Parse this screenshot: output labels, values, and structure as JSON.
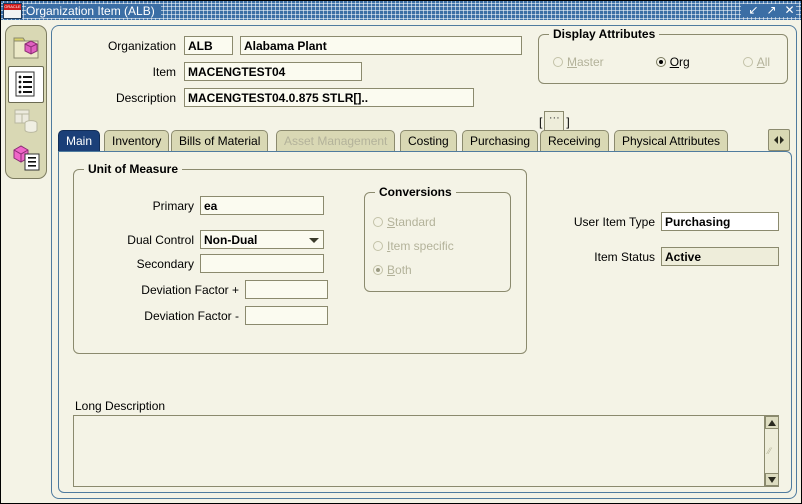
{
  "window": {
    "title": "Organization Item (ALB)",
    "logo_text": "ORACLE",
    "buttons": [
      {
        "name": "minimize",
        "glyph": "↙"
      },
      {
        "name": "maximize",
        "glyph": "↗"
      },
      {
        "name": "close",
        "glyph": "✕"
      }
    ]
  },
  "sidebar": {
    "items": [
      {
        "name": "folder-cube-icon",
        "label": "Navigator Folder",
        "state": "enabled"
      },
      {
        "name": "list-document-icon",
        "label": "Item List",
        "state": "selected"
      },
      {
        "name": "window-database-icon",
        "label": "Data Window",
        "state": "disabled"
      },
      {
        "name": "cube-list-icon",
        "label": "Item Attributes",
        "state": "enabled"
      }
    ]
  },
  "header": {
    "organization": {
      "label": "Organization",
      "code_value": "ALB",
      "name_value": "Alabama Plant"
    },
    "item": {
      "label": "Item",
      "value": "MACENGTEST04"
    },
    "description": {
      "label": "Description",
      "value": "MACENGTEST04.0.875 STLR[]..",
      "lov_open": "[",
      "lov_glyph": "···",
      "lov_close": "]"
    }
  },
  "display_attributes": {
    "title": "Display Attributes",
    "options": [
      {
        "label_pre": "",
        "label_accel": "M",
        "label_post": "aster",
        "selected": false,
        "disabled": true
      },
      {
        "label_pre": "",
        "label_accel": "O",
        "label_post": "rg",
        "selected": true,
        "disabled": false
      },
      {
        "label_pre": "",
        "label_accel": "A",
        "label_post": "ll",
        "selected": false,
        "disabled": true
      }
    ]
  },
  "tabs": {
    "items": [
      {
        "label": "Main",
        "selected": true,
        "disabled": false
      },
      {
        "label": "Inventory",
        "selected": false,
        "disabled": false
      },
      {
        "label": "Bills of Material",
        "selected": false,
        "disabled": false
      },
      {
        "label": "Asset Management",
        "selected": false,
        "disabled": true
      },
      {
        "label": "Costing",
        "selected": false,
        "disabled": false
      },
      {
        "label": "Purchasing",
        "selected": false,
        "disabled": false
      },
      {
        "label": "Receiving",
        "selected": false,
        "disabled": false
      },
      {
        "label": "Physical Attributes",
        "selected": false,
        "disabled": false
      }
    ],
    "nav_button_name": "tab-scroll-button"
  },
  "main_tab": {
    "uom": {
      "title": "Unit of Measure",
      "primary": {
        "label": "Primary",
        "value": "ea"
      },
      "dual_control": {
        "label": "Dual Control",
        "value": "Non-Dual"
      },
      "secondary": {
        "label": "Secondary",
        "value": ""
      },
      "deviation_plus": {
        "label": "Deviation Factor +",
        "value": ""
      },
      "deviation_minus": {
        "label": "Deviation Factor -",
        "value": ""
      },
      "conversions": {
        "title": "Conversions",
        "options": [
          {
            "label_accel": "S",
            "label_post": "tandard",
            "selected": false,
            "disabled": true
          },
          {
            "label_accel": "I",
            "label_post": "tem specific",
            "selected": false,
            "disabled": true
          },
          {
            "label_accel": "B",
            "label_post": "oth",
            "selected": true,
            "disabled": true
          }
        ]
      }
    },
    "user_item_type": {
      "label": "User Item Type",
      "value": "Purchasing"
    },
    "item_status": {
      "label": "Item Status",
      "value": "Active"
    },
    "long_description": {
      "label": "Long Description",
      "value": ""
    }
  },
  "colors": {
    "titlebar": "#3b6ea5",
    "canvas": "#f4f3e6",
    "tab_selected": "#1b3f78",
    "tab_normal": "#d9d8b4",
    "field_border": "#8b8a6e",
    "disabled_text": "#b3b29a",
    "accent_border": "#4f7b9e"
  }
}
